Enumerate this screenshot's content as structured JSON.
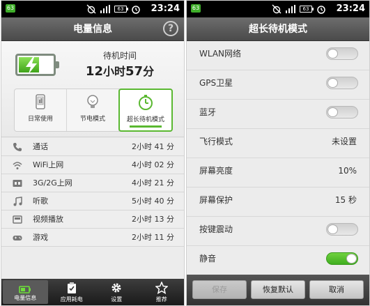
{
  "status_bar": {
    "badge": "63",
    "battery": "63",
    "time": "23:24"
  },
  "left": {
    "title": "电量信息",
    "help": "?",
    "standby_label": "待机时间",
    "standby_hours": "12",
    "standby_hours_unit": "小时",
    "standby_minutes": "57",
    "standby_minutes_unit": "分",
    "battery_level": 0.55,
    "modes": [
      {
        "label": "日常使用",
        "icon": "phone-icon",
        "active": false
      },
      {
        "label": "节电模式",
        "icon": "lightbulb-icon",
        "active": false
      },
      {
        "label": "超长待机模式",
        "icon": "clock-icon",
        "active": true
      }
    ],
    "usage": [
      {
        "name": "通话",
        "value": "2小时 41 分",
        "icon": "call-icon"
      },
      {
        "name": "WiFi上网",
        "value": "4小时 02 分",
        "icon": "wifi-icon"
      },
      {
        "name": "3G/2G上网",
        "value": "4小时 21 分",
        "icon": "3g-icon"
      },
      {
        "name": "听歌",
        "value": "5小时 40 分",
        "icon": "music-icon"
      },
      {
        "name": "视频播放",
        "value": "2小时 13 分",
        "icon": "video-icon"
      },
      {
        "name": "游戏",
        "value": "2小时 11 分",
        "icon": "gamepad-icon"
      }
    ],
    "nav": [
      {
        "label": "电量信息",
        "icon": "battery-icon",
        "active": true
      },
      {
        "label": "应用耗电",
        "icon": "clipboard-icon",
        "active": false
      },
      {
        "label": "设置",
        "icon": "gear-icon",
        "active": false
      },
      {
        "label": "推荐",
        "icon": "star-icon",
        "active": false
      }
    ]
  },
  "right": {
    "title": "超长待机模式",
    "settings": [
      {
        "name": "WLAN网络",
        "type": "toggle",
        "on": false
      },
      {
        "name": "GPS卫星",
        "type": "toggle",
        "on": false
      },
      {
        "name": "蓝牙",
        "type": "toggle",
        "on": false
      },
      {
        "name": "飞行模式",
        "type": "value",
        "value": "未设置"
      },
      {
        "name": "屏幕亮度",
        "type": "value",
        "value": "10%"
      },
      {
        "name": "屏幕保护",
        "type": "value",
        "value": "15 秒"
      },
      {
        "name": "按键震动",
        "type": "toggle",
        "on": false
      },
      {
        "name": "静音",
        "type": "toggle",
        "on": true
      }
    ],
    "buttons": {
      "save": "保存",
      "restore": "恢复默认",
      "cancel": "取消"
    }
  },
  "colors": {
    "accent_green": "#5ab831",
    "title_bar": "#555555",
    "toggle_on": "#4cbf24"
  }
}
